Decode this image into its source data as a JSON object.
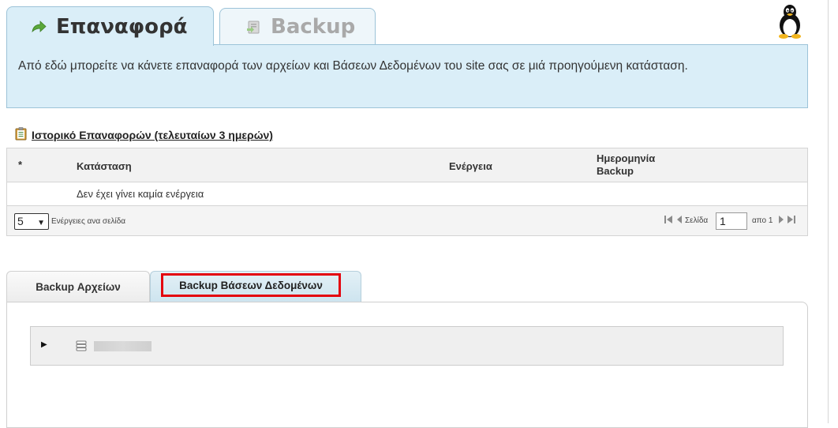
{
  "top_tabs": [
    {
      "label": "Επαναφορά",
      "icon": "arrow-restore-icon",
      "active": true
    },
    {
      "label": "Backup",
      "icon": "backup-icon",
      "active": false
    }
  ],
  "os_icon": "linux-tux-icon",
  "info": {
    "text": "Από εδώ μπορείτε να κάνετε επαναφορά των αρχείων και Βάσεων Δεδομένων του site σας σε μιά προηγούμενη κατάσταση."
  },
  "history": {
    "title": "Ιστορικό Επαναφορών (τελευταίων 3 ημερών)",
    "icon": "clipboard-icon",
    "columns": [
      "*",
      "Κατάσταση",
      "Ενέργεια",
      "Ημερομηνία Backup"
    ],
    "empty_message": "Δεν έχει γίνει καμία ενέργεια",
    "pager": {
      "per_page": "5",
      "per_page_label": "Ενέργειες ανα σελίδα",
      "page_label": "Σελίδα",
      "page_value": "1",
      "of_label": "απο 1"
    }
  },
  "lower_tabs": [
    {
      "label": "Backup Αρχείων",
      "active": false
    },
    {
      "label": "Backup Βάσεων Δεδομένων",
      "active": true,
      "highlighted": true
    }
  ],
  "tree": {
    "expand_icon": "triangle-right-icon",
    "item_icon": "database-icon"
  },
  "colors": {
    "accent_blue": "#daeef8",
    "border_blue": "#9cc3d8",
    "highlight_red": "#e4040f",
    "green_arrow": "#5aa83a"
  }
}
